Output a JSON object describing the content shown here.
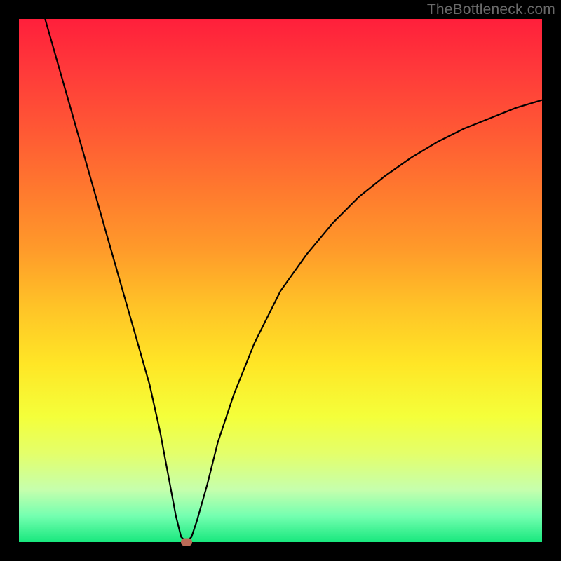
{
  "watermark": "TheBottleneck.com",
  "colors": {
    "frame": "#000000",
    "curve": "#000000",
    "marker": "#bb6a57"
  },
  "chart_data": {
    "type": "line",
    "title": "",
    "xlabel": "",
    "ylabel": "",
    "xlim": [
      0,
      100
    ],
    "ylim": [
      0,
      100
    ],
    "grid": false,
    "legend": false,
    "series": [
      {
        "name": "curve",
        "x": [
          5,
          7,
          9,
          11,
          13,
          15,
          17,
          19,
          21,
          23,
          25,
          27,
          28.5,
          30,
          31,
          32,
          33,
          34,
          36,
          38,
          41,
          45,
          50,
          55,
          60,
          65,
          70,
          75,
          80,
          85,
          90,
          95,
          100
        ],
        "y": [
          100,
          93,
          86,
          79,
          72,
          65,
          58,
          51,
          44,
          37,
          30,
          21,
          13,
          5,
          1,
          0,
          1,
          4,
          11,
          19,
          28,
          38,
          48,
          55,
          61,
          66,
          70,
          73.5,
          76.5,
          79,
          81,
          83,
          84.5
        ]
      }
    ],
    "marker": {
      "x": 32,
      "y": 0
    },
    "gradient_stops": [
      {
        "pos": 0.0,
        "color": "#ff1f3b"
      },
      {
        "pos": 0.1,
        "color": "#ff3a3a"
      },
      {
        "pos": 0.22,
        "color": "#ff5a34"
      },
      {
        "pos": 0.33,
        "color": "#ff7a2e"
      },
      {
        "pos": 0.44,
        "color": "#ff9a2a"
      },
      {
        "pos": 0.55,
        "color": "#ffc327"
      },
      {
        "pos": 0.66,
        "color": "#ffe626"
      },
      {
        "pos": 0.76,
        "color": "#f4ff3a"
      },
      {
        "pos": 0.83,
        "color": "#e4ff6a"
      },
      {
        "pos": 0.9,
        "color": "#c6ffad"
      },
      {
        "pos": 0.95,
        "color": "#74ffb0"
      },
      {
        "pos": 1.0,
        "color": "#18e87e"
      }
    ]
  }
}
